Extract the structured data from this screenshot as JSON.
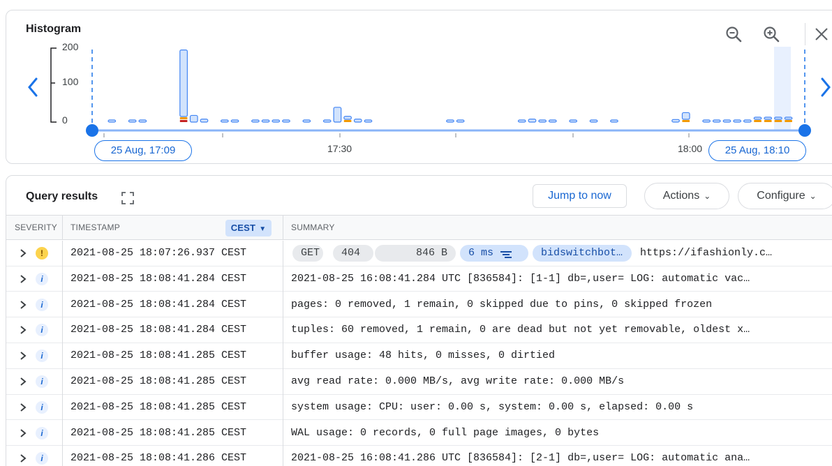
{
  "histogram": {
    "title": "Histogram",
    "y_ticks": [
      "200",
      "100",
      "0"
    ],
    "start_chip": "25 Aug, 17:09",
    "end_chip": "25 Aug, 18:10",
    "time_labels": [
      "17:30",
      "18:00"
    ],
    "icons": [
      "zoom-out-icon",
      "zoom-in-icon",
      "close-icon",
      "chevron-left-icon",
      "chevron-right-icon"
    ],
    "colors": {
      "bar_fill": "#d2e3fc",
      "bar_stroke": "#4285f4",
      "warning": "#f29900",
      "error": "#c5221f",
      "accent": "#1a73e8"
    }
  },
  "chart_data": {
    "type": "bar",
    "ylim": [
      0,
      200
    ],
    "y_ticks": [
      0,
      100,
      200
    ],
    "x_range": [
      "25 Aug, 17:09",
      "25 Aug, 18:10"
    ],
    "x_tick_labels": [
      "17:30",
      "18:00"
    ],
    "series": [
      {
        "name": "",
        "values": [
          1,
          0,
          1,
          1,
          0,
          0,
          0,
          180,
          18,
          8,
          0,
          1,
          1,
          0,
          1,
          1,
          1,
          1,
          0,
          1,
          0,
          1,
          40,
          8,
          8,
          5,
          0,
          0,
          0,
          0,
          0,
          0,
          0,
          1,
          1,
          0,
          0,
          0,
          0,
          0,
          1,
          8,
          1,
          1,
          0,
          1,
          0,
          1,
          0,
          1,
          0,
          0,
          0,
          0,
          0,
          7,
          18,
          0,
          1,
          1,
          1,
          1,
          1,
          1,
          1,
          5,
          1
        ]
      },
      {
        "name": "",
        "values": [
          0,
          0,
          0,
          0,
          0,
          0,
          0,
          4,
          0,
          0,
          0,
          0,
          0,
          0,
          0,
          0,
          0,
          0,
          0,
          0,
          0,
          0,
          0,
          2,
          0,
          0,
          0,
          0,
          0,
          0,
          0,
          0,
          0,
          0,
          0,
          0,
          0,
          0,
          0,
          0,
          0,
          0,
          0,
          0,
          0,
          0,
          0,
          0,
          0,
          0,
          0,
          0,
          0,
          0,
          0,
          0,
          2,
          0,
          0,
          0,
          0,
          0,
          0,
          1,
          1,
          2,
          1
        ]
      },
      {
        "name": "",
        "values": [
          0,
          0,
          0,
          0,
          0,
          0,
          0,
          4,
          0,
          0,
          0,
          0,
          0,
          0,
          0,
          0,
          0,
          0,
          0,
          0,
          0,
          0,
          0,
          0,
          0,
          0,
          0,
          0,
          0,
          0,
          0,
          0,
          0,
          0,
          0,
          0,
          0,
          0,
          0,
          0,
          0,
          0,
          0,
          0,
          0,
          0,
          0,
          0,
          0,
          0,
          0,
          0,
          0,
          0,
          0,
          0,
          0,
          0,
          0,
          0,
          0,
          0,
          0,
          0,
          0,
          0,
          0
        ]
      }
    ]
  },
  "results": {
    "title": "Query results",
    "jump_label": "Jump to now",
    "actions_label": "Actions",
    "configure_label": "Configure",
    "columns": {
      "severity": "SEVERITY",
      "timestamp": "TIMESTAMP",
      "timezone": "CEST",
      "summary": "SUMMARY"
    },
    "first_row_pills": {
      "method": "GET",
      "status": "404",
      "size": "846 B",
      "latency": "6 ms",
      "agent": "bidswitchbot…",
      "url": "https://ifashionly.c…"
    },
    "rows": [
      {
        "severity": "warning",
        "timestamp": "2021-08-25 18:07:26.937 CEST",
        "summary": ""
      },
      {
        "severity": "info",
        "timestamp": "2021-08-25 18:08:41.284 CEST",
        "summary": "2021-08-25 16:08:41.284 UTC [836584]: [1-1] db=,user= LOG: automatic vac…"
      },
      {
        "severity": "info",
        "timestamp": "2021-08-25 18:08:41.284 CEST",
        "summary": "pages: 0 removed, 1 remain, 0 skipped due to pins, 0 skipped frozen"
      },
      {
        "severity": "info",
        "timestamp": "2021-08-25 18:08:41.284 CEST",
        "summary": "tuples: 60 removed, 1 remain, 0 are dead but not yet removable, oldest x…"
      },
      {
        "severity": "info",
        "timestamp": "2021-08-25 18:08:41.285 CEST",
        "summary": "buffer usage: 48 hits, 0 misses, 0 dirtied"
      },
      {
        "severity": "info",
        "timestamp": "2021-08-25 18:08:41.285 CEST",
        "summary": "avg read rate: 0.000 MB/s, avg write rate: 0.000 MB/s"
      },
      {
        "severity": "info",
        "timestamp": "2021-08-25 18:08:41.285 CEST",
        "summary": "system usage: CPU: user: 0.00 s, system: 0.00 s, elapsed: 0.00 s"
      },
      {
        "severity": "info",
        "timestamp": "2021-08-25 18:08:41.285 CEST",
        "summary": "WAL usage: 0 records, 0 full page images, 0 bytes"
      },
      {
        "severity": "info",
        "timestamp": "2021-08-25 18:08:41.286 CEST",
        "summary": "2021-08-25 16:08:41.286 UTC [836584]: [2-1] db=,user= LOG: automatic ana…"
      }
    ],
    "severity_glyphs": {
      "warning": "!",
      "info": "i"
    }
  }
}
